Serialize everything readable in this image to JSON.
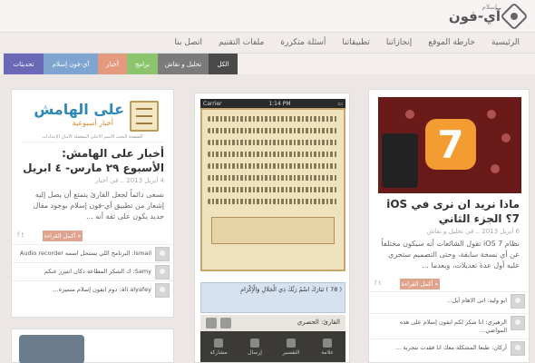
{
  "site": {
    "logo_text": "آي-فون",
    "logo_small": "إسلام"
  },
  "mainnav": [
    "الرئيسية",
    "خارطة الموقع",
    "إنجازاتنا",
    "تطبيقاتنا",
    "أسئلة متكررة",
    "ملفات التقنيم",
    "اتصل بنا"
  ],
  "categories": [
    {
      "label": "الكل",
      "color": "#4a4a4a"
    },
    {
      "label": "تحليل و نقاش",
      "color": "#7b7b7b"
    },
    {
      "label": "برامج",
      "color": "#8cc46e"
    },
    {
      "label": "أخبار",
      "color": "#e39a7e"
    },
    {
      "label": "آي-فون إسلام",
      "color": "#7ea4cf"
    },
    {
      "label": "تحديثات",
      "color": "#6b68b8"
    }
  ],
  "left_post": {
    "banner_title": "على الهامش",
    "banner_sub": "أخبار أسبوعية",
    "banner_nav": "الصفحة   البحث   الاسم   الأعلى   المفضلة   الأمان   الإعدادات",
    "title": "أخبار على الهامش: الأسبوع ٢٩ مارس- ٤ ابريل",
    "meta": "4 أبريل 2013 .. في أخبار",
    "excerpt": "نسعى دائماً لجعل القارئ يتمتع أن يصل إليه إشعار من تطبيق آي-فون إسلام بوجود مقال جديد يكون على ثقة أنه ...",
    "more": "أكمل القراءة »",
    "comments": [
      "Ismail: البرنامج اللي يستحل اسمه Audio recorder",
      "Samy: ك الشكر المطاعة دكان انتبرز عنكم",
      "ali alyafey: دوم ايفون إسلام متميزة..."
    ]
  },
  "mid_post": {
    "carrier": "Carrier",
    "time": "1:14 PM",
    "verse": "( 78 )  تَبَارَكَ اسْمُ رَبِّكَ ذِي الْجَلَالِ وَالْإِكْرَامِ",
    "reader": "القارئ: الحصري",
    "tabs": [
      "علامة",
      "التفسير",
      "إرسال",
      "مشاركة"
    ]
  },
  "right_post": {
    "title": "ماذا نريد ان نرى في iOS 7؟ الجزء الثاني",
    "meta": "6 أبريل 2013 .. في تحليل و نقاش",
    "excerpt": "نظام iOS 7 تقول الشائعات أنه سيكون مختلفاً عن أي نسخة سابقة، وحتى التصميم ستجري عليه أول عدة تعديلات، وبعدما ...",
    "more": "أكمل القراءة »",
    "comments": [
      "ابو وليد: اتی الاهام أيل...",
      "الزهيري: انا شكر لكم ايفون إسلام على هذه المواضي...",
      "أرکان: طبعا المشكلة معك انا فقدت بتجربة ..."
    ]
  },
  "badge_7": "7"
}
